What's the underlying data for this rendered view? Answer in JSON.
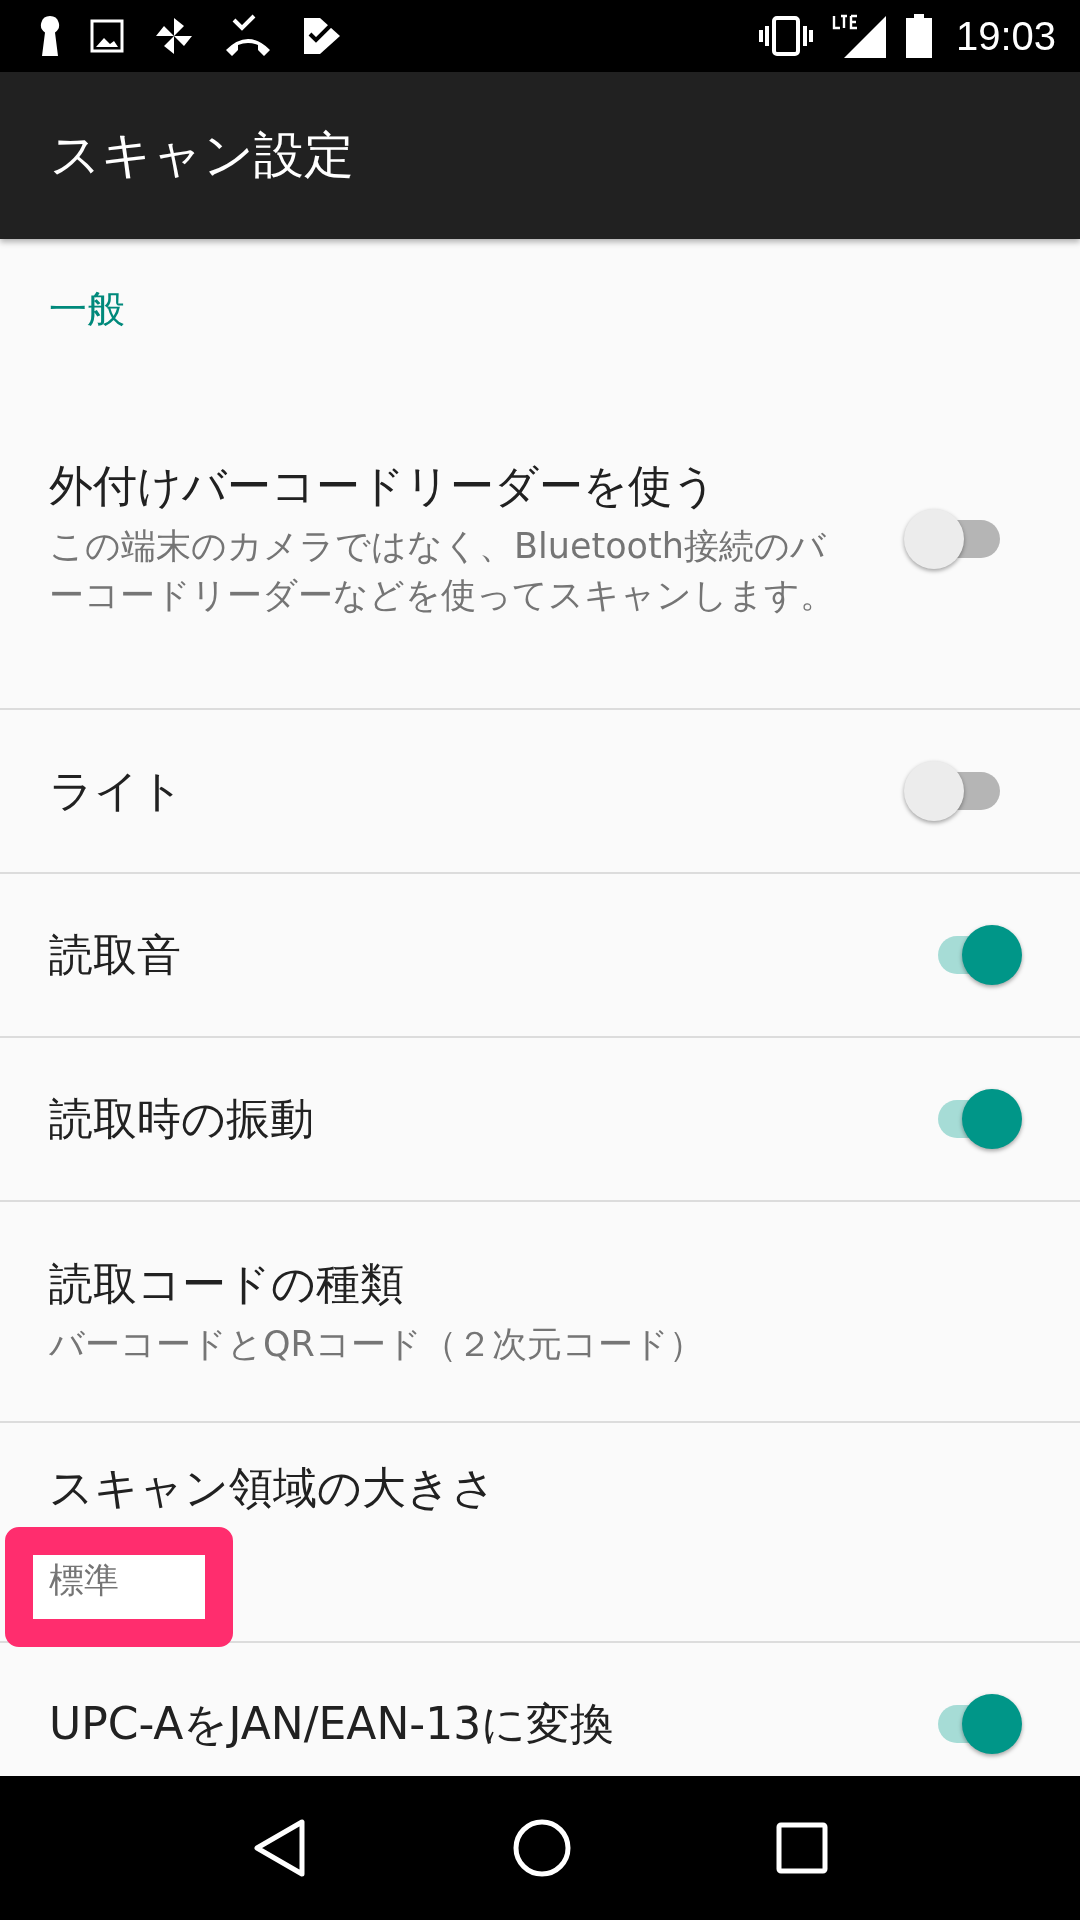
{
  "status_bar": {
    "time": "19:03"
  },
  "app_bar": {
    "title": "スキャン設定"
  },
  "section": {
    "title": "一般"
  },
  "settings": [
    {
      "kind": "toggle",
      "title": "外付けバーコードリーダーを使う",
      "summary": "この端末のカメラではなく、Bluetooth接続のバーコードリーダーなどを使ってスキャンします。",
      "on": false
    },
    {
      "kind": "toggle",
      "title": "ライト",
      "on": false
    },
    {
      "kind": "toggle",
      "title": "読取音",
      "on": true
    },
    {
      "kind": "toggle",
      "title": "読取時の振動",
      "on": true
    },
    {
      "kind": "choice",
      "title": "読取コードの種類",
      "summary": "バーコードとQRコード（２次元コード）"
    },
    {
      "kind": "choice",
      "title": "スキャン領域の大きさ",
      "summary": "標準",
      "highlighted": true
    },
    {
      "kind": "toggle",
      "title": "UPC-AをJAN/EAN-13に変換",
      "on": true
    }
  ]
}
